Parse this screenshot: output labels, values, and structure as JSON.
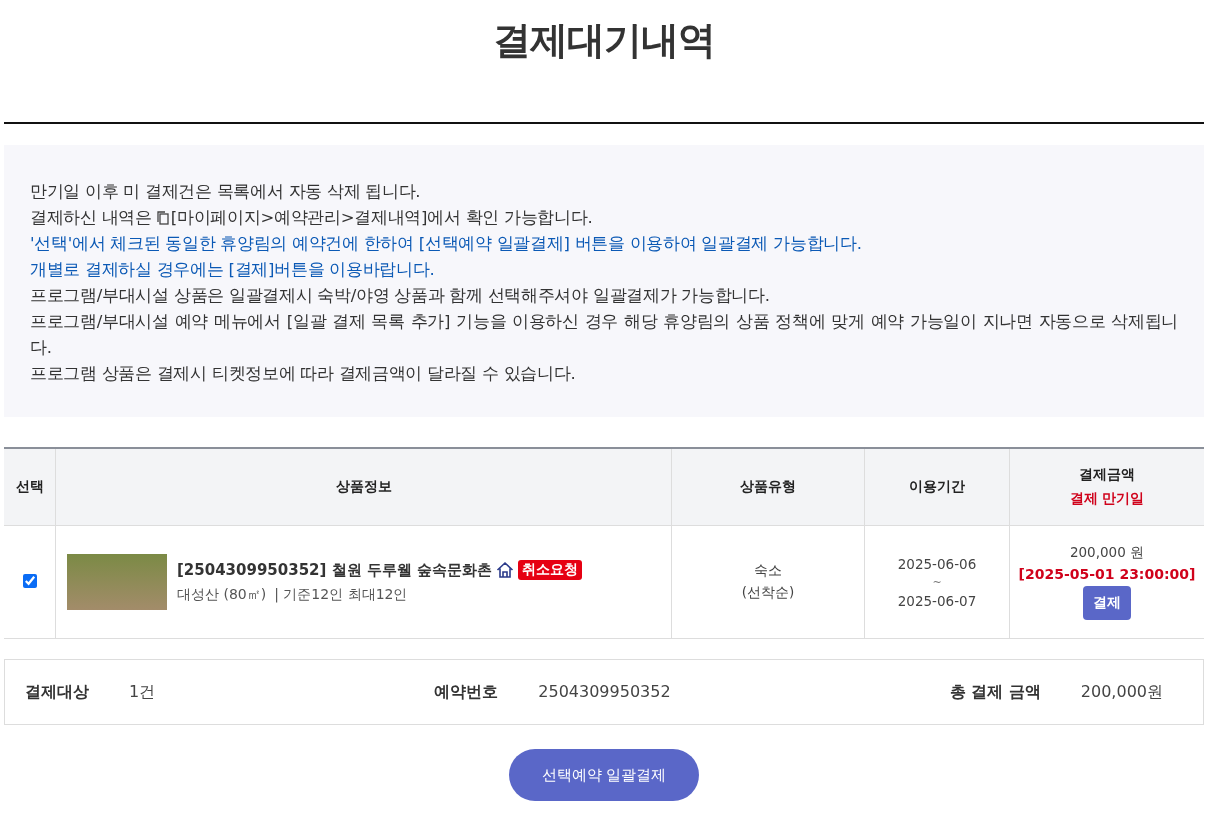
{
  "title": "결제대기내역",
  "notices": [
    {
      "kind": "plain",
      "text": "만기일 이후 미 결제건은 목록에서 자동 삭제 됩니다."
    },
    {
      "kind": "link",
      "before": "결제하신 내역은 ",
      "link": "[마이페이지>예약관리>결제내역]",
      "after": "에서 확인 가능합니다."
    },
    {
      "kind": "blue",
      "text": "'선택'에서 체크된 동일한 휴양림의 예약건에 한하여 [선택예약 일괄결제] 버튼을 이용하여 일괄결제 가능합니다."
    },
    {
      "kind": "blue",
      "text": "개별로 결제하실 경우에는 [결제]버튼을 이용바랍니다."
    },
    {
      "kind": "plain",
      "text": "프로그램/부대시설 상품은 일괄결제시 숙박/야영 상품과 함께 선택해주셔야 일괄결제가 가능합니다."
    },
    {
      "kind": "plain",
      "text": "프로그램/부대시설 예약 메뉴에서 [일괄 결제 목록 추가] 기능을 이용하신 경우 해당 휴양림의 상품 정책에 맞게 예약 가능일이 지나면 자동으로 삭제됩니다."
    },
    {
      "kind": "plain",
      "text": "프로그램 상품은 결제시 티켓정보에 따라 결제금액이 달라질 수 있습니다."
    }
  ],
  "table": {
    "columns": [
      {
        "label": "선택"
      },
      {
        "label": "상품정보"
      },
      {
        "label": "상품유형"
      },
      {
        "label": "이용기간"
      },
      {
        "label": "결제금액",
        "sub": "결제 만기일"
      }
    ],
    "rows": [
      {
        "checked": true,
        "product_title": "[2504309950352] 철원 두루웰 숲속문화촌",
        "badge": "취소요청",
        "detail": "대성산 (80㎡)",
        "capacity": "| 기준12인 최대12인",
        "type": "숙소",
        "type_note": "(선착순)",
        "start": "2025-06-06",
        "range_sep": "~",
        "end": "2025-06-07",
        "amount": "200,000 원",
        "deadline": "[2025-05-01 23:00:00]",
        "pay_button": "결제"
      }
    ]
  },
  "summary": [
    {
      "label": "결제대상",
      "value": "1건"
    },
    {
      "label": "예약번호",
      "value": "2504309950352"
    },
    {
      "label": "총 결제 금액",
      "value": "200,000원"
    }
  ],
  "batch_button": "선택예약 일괄결제"
}
